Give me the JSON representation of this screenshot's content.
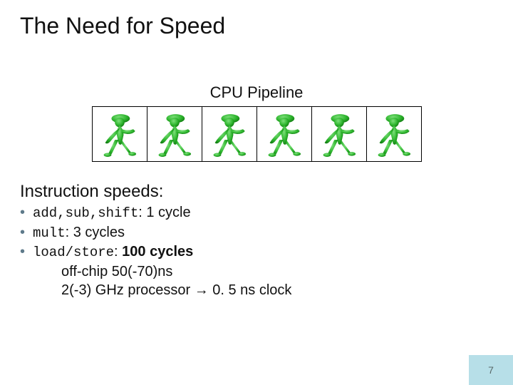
{
  "title": "The Need for Speed",
  "subtitle": "CPU Pipeline",
  "pipeline": {
    "count": 6,
    "icon": "ampelmann-walk"
  },
  "section_heading": "Instruction speeds:",
  "bullets": [
    {
      "mono": "add,sub,shift",
      "after": ":  1 cycle"
    },
    {
      "mono": "mult",
      "after": ": 3 cycles"
    },
    {
      "mono": "load/store",
      "after": ": ",
      "bold_after": "100 cycles"
    }
  ],
  "sublines": [
    "off-chip 50(-70)ns",
    "2(-3) GHz processor → 0. 5 ns clock"
  ],
  "page_number": "7"
}
